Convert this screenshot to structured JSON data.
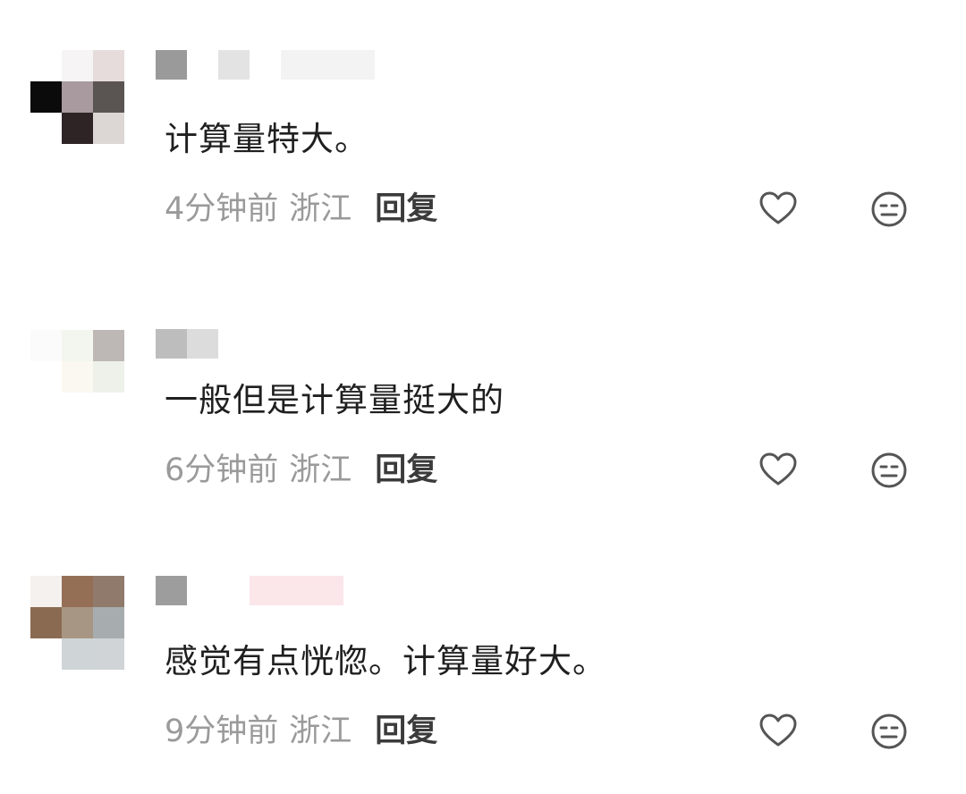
{
  "comments": [
    {
      "text": "计算量特大。",
      "time": "4分钟前",
      "location": "浙江",
      "reply": "回复"
    },
    {
      "text": "一般但是计算量挺大的",
      "time": "6分钟前",
      "location": "浙江",
      "reply": "回复"
    },
    {
      "text": "感觉有点恍惚。计算量好大。",
      "time": "9分钟前",
      "location": "浙江",
      "reply": "回复"
    }
  ],
  "icons": {
    "like": "heart-outline-icon",
    "dislike": "neutral-face-icon"
  },
  "colors": {
    "text": "#1f1f1f",
    "meta": "#9a9a9a",
    "reply": "#3b3b3b",
    "icon": "#555555"
  }
}
